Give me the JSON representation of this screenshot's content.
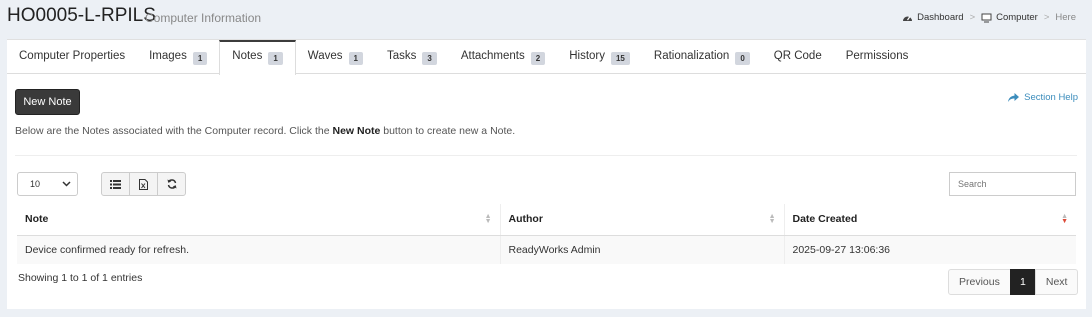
{
  "header": {
    "title": "HO0005-L-RPILS",
    "subtitle": "Computer Information",
    "breadcrumb": [
      {
        "label": "Dashboard",
        "icon": "dashboard-icon"
      },
      {
        "label": "Computer",
        "icon": "monitor-icon"
      },
      {
        "label": "Here"
      }
    ]
  },
  "tabs": [
    {
      "label": "Computer Properties",
      "badge": null
    },
    {
      "label": "Images",
      "badge": "1"
    },
    {
      "label": "Notes",
      "badge": "1",
      "active": true
    },
    {
      "label": "Waves",
      "badge": "1"
    },
    {
      "label": "Tasks",
      "badge": "3"
    },
    {
      "label": "Attachments",
      "badge": "2"
    },
    {
      "label": "History",
      "badge": "15"
    },
    {
      "label": "Rationalization",
      "badge": "0"
    },
    {
      "label": "QR Code",
      "badge": null
    },
    {
      "label": "Permissions",
      "badge": null
    }
  ],
  "toolbar": {
    "new_note_label": "New Note",
    "help_label": "Section Help"
  },
  "intro": {
    "before": "Below are the Notes associated with the Computer record. Click the ",
    "bold": "New Note",
    "after": " button to create new a Note."
  },
  "table_controls": {
    "page_length": "10",
    "search_placeholder": "Search"
  },
  "table": {
    "columns": [
      "Note",
      "Author",
      "Date Created"
    ],
    "rows": [
      [
        "Device confirmed ready for refresh.",
        "ReadyWorks Admin",
        "2025-09-27 13:06:36"
      ]
    ]
  },
  "footer": {
    "info": "Showing 1 to 1 of 1 entries",
    "pagination": {
      "previous": "Previous",
      "current": "1",
      "next": "Next"
    }
  }
}
